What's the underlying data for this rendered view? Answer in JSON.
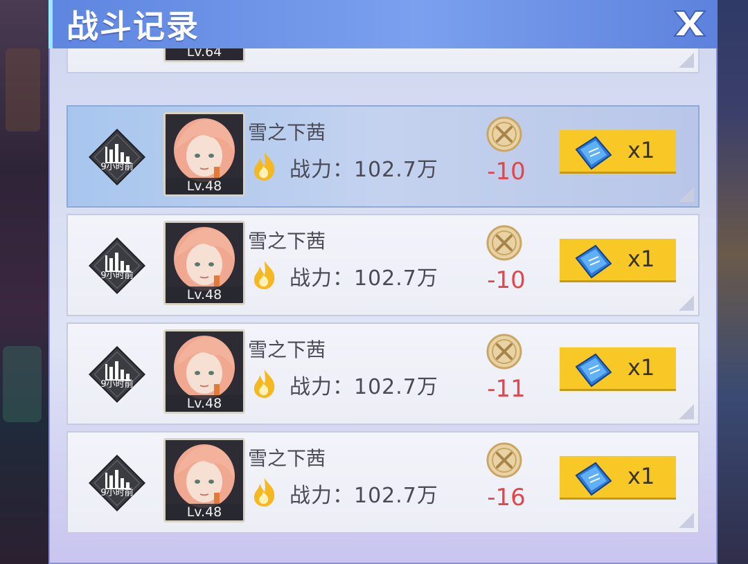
{
  "title": "战斗记录",
  "records": [
    {
      "time": "9小时前",
      "name": "雪之下茜",
      "level": "Lv.48",
      "power": "战力：102.7万",
      "delta": "-10",
      "reward_qty": "x1",
      "selected": true
    },
    {
      "time": "9小时前",
      "name": "雪之下茜",
      "level": "Lv.48",
      "power": "战力：102.7万",
      "delta": "-10",
      "reward_qty": "x1",
      "selected": false
    },
    {
      "time": "9小时前",
      "name": "雪之下茜",
      "level": "Lv.48",
      "power": "战力：102.7万",
      "delta": "-11",
      "reward_qty": "x1",
      "selected": false
    },
    {
      "time": "9小时前",
      "name": "雪之下茜",
      "level": "Lv.48",
      "power": "战力：102.7万",
      "delta": "-16",
      "reward_qty": "x1",
      "selected": false
    }
  ],
  "partial_top_row": {
    "level": "Lv.64"
  },
  "icons": {
    "close": "close-icon",
    "stats": "bar-chart-icon",
    "power": "flame-icon",
    "score": "crossed-swords-coin-icon",
    "reward": "ticket-icon"
  },
  "colors": {
    "title_bar": "#6b90e6",
    "delta_negative": "#e3454b",
    "reward_button": "#f7c826",
    "selected_row": "#b4c8ee"
  }
}
